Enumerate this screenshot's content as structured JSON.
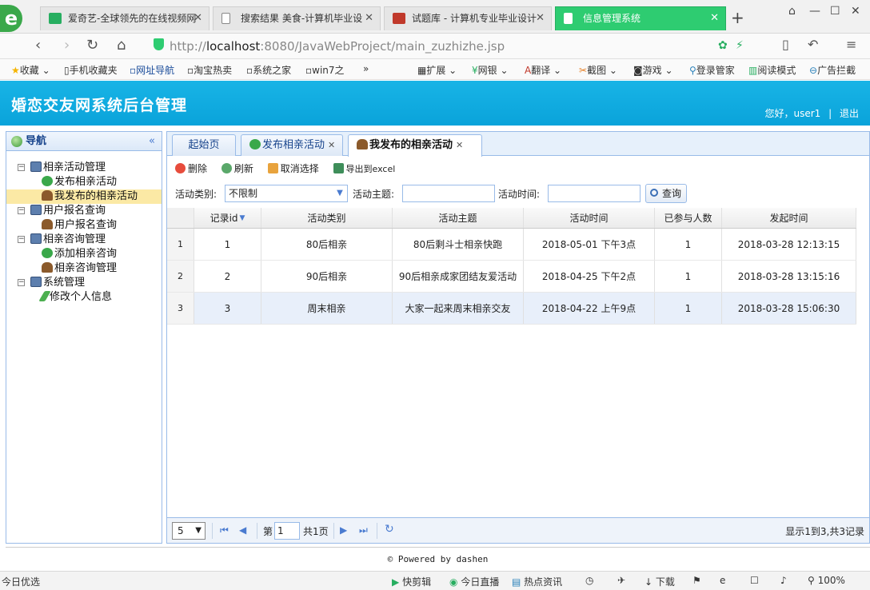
{
  "browser": {
    "tabs": [
      {
        "label": "爱奇艺-全球领先的在线视频网",
        "icon_color": "#27ae60"
      },
      {
        "label": "搜索结果 美食-计算机毕业设",
        "icon_color": "#ffffff"
      },
      {
        "label": "试题库 - 计算机专业毕业设计",
        "icon_color": "#c0392b"
      },
      {
        "label": "信息管理系统",
        "icon_color": "#2ecc71"
      }
    ],
    "url_prefix": "http://",
    "url_host": "localhost",
    "url_rest": ":8080/JavaWebProject/main_zuzhizhe.jsp",
    "bookmarks": [
      "收藏",
      "手机收藏夹",
      "网址导航",
      "淘宝热卖",
      "系统之家",
      "win7之"
    ],
    "toolbar_right": [
      "扩展",
      "网银",
      "翻译",
      "截图",
      "游戏",
      "登录管家",
      "阅读模式",
      "广告拦截"
    ],
    "status_left": "今日优选",
    "status_right": [
      "快剪辑",
      "今日直播",
      "热点资讯",
      "下载",
      "100%"
    ]
  },
  "header": {
    "title": "婚恋交友网系统后台管理",
    "greeting": "您好，user1",
    "logout": "退出"
  },
  "nav": {
    "title": "导航",
    "collapse": "«",
    "groups": [
      {
        "label": "相亲活动管理",
        "items": [
          {
            "label": "发布相亲活动",
            "icon": "plus"
          },
          {
            "label": "我发布的相亲活动",
            "icon": "user"
          }
        ]
      },
      {
        "label": "用户报名查询",
        "items": [
          {
            "label": "用户报名查询",
            "icon": "user"
          }
        ]
      },
      {
        "label": "相亲咨询管理",
        "items": [
          {
            "label": "添加相亲咨询",
            "icon": "plus"
          },
          {
            "label": "相亲咨询管理",
            "icon": "user"
          }
        ]
      },
      {
        "label": "系统管理",
        "items": [
          {
            "label": "修改个人信息",
            "icon": "pencil"
          }
        ]
      }
    ]
  },
  "tabs": [
    {
      "label": "起始页"
    },
    {
      "label": "发布相亲活动"
    },
    {
      "label": "我发布的相亲活动"
    }
  ],
  "toolbar": {
    "delete": "删除",
    "refresh": "刷新",
    "cancel": "取消选择",
    "export": "导出到excel"
  },
  "filters": {
    "type_label": "活动类别:",
    "type_value": "不限制",
    "topic_label": "活动主题:",
    "topic_value": "",
    "time_label": "活动时间:",
    "time_value": "",
    "query": "查询"
  },
  "grid": {
    "columns": [
      "记录id",
      "活动类别",
      "活动主题",
      "活动时间",
      "已参与人数",
      "发起时间"
    ],
    "rows": [
      {
        "rn": "1",
        "cells": [
          "1",
          "80后相亲",
          "80后剩斗士相亲快跑",
          "2018-05-01 下午3点",
          "1",
          "2018-03-28 12:13:15"
        ]
      },
      {
        "rn": "2",
        "cells": [
          "2",
          "90后相亲",
          "90后相亲成家团结友爱活动",
          "2018-04-25 下午2点",
          "1",
          "2018-03-28 13:15:16"
        ]
      },
      {
        "rn": "3",
        "cells": [
          "3",
          "周末相亲",
          "大家一起来周末相亲交友",
          "2018-04-22 上午9点",
          "1",
          "2018-03-28 15:06:30"
        ]
      }
    ]
  },
  "pager": {
    "page_size": "5",
    "page_prefix": "第",
    "page_value": "1",
    "page_suffix": "共1页",
    "info": "显示1到3,共3记录"
  },
  "footer": "© Powered by dashen"
}
